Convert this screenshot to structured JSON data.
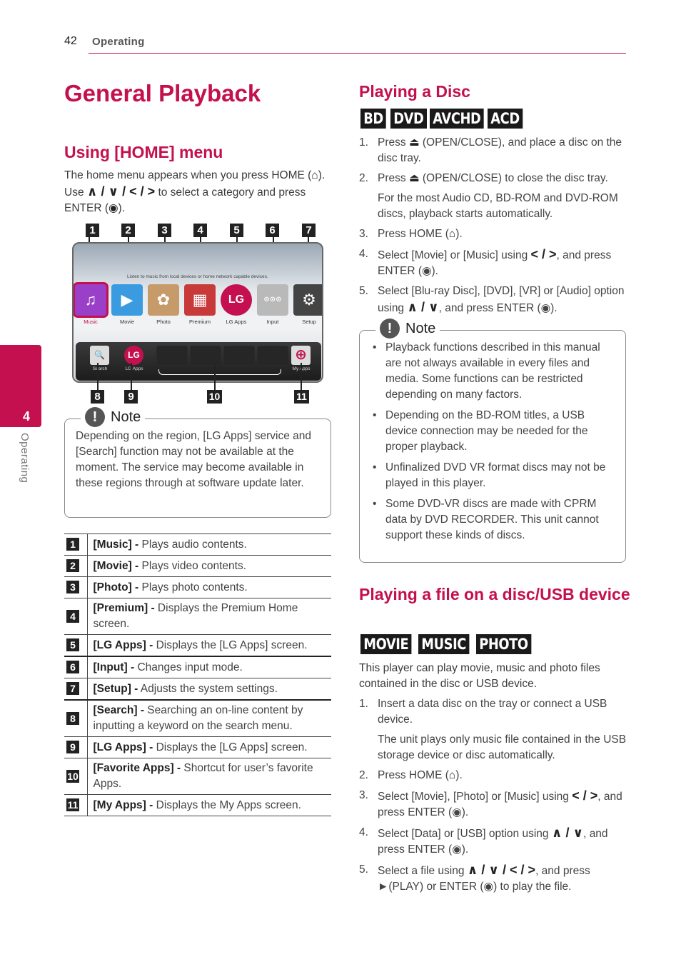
{
  "header": {
    "page_number": "42",
    "section": "Operating"
  },
  "side_tab": {
    "chapter_number": "4",
    "chapter_label": "Operating"
  },
  "title": "General Playback",
  "home_menu": {
    "heading": "Using [HOME] menu",
    "intro_1": "The home menu appears when you press HOME (",
    "home_icon": "⌂",
    "intro_2": "). Use ",
    "arrows_all": "∧ / ∨ / < / >",
    "intro_3": " to select a category and press ENTER (",
    "enter_icon": "◉",
    "intro_4": ").",
    "screen": {
      "hint": "Listen to music from local devices or home network capable devices.",
      "apps": [
        {
          "label": "Music",
          "icon": "music-note-icon",
          "glyph": "♫",
          "color": "#9a3fc7"
        },
        {
          "label": "Movie",
          "icon": "clapperboard-icon",
          "glyph": "▶",
          "color": "#3a9be0"
        },
        {
          "label": "Photo",
          "icon": "flower-photo-icon",
          "glyph": "✿",
          "color": "#c79a6a"
        },
        {
          "label": "Premium",
          "icon": "premium-grid-icon",
          "glyph": "▦",
          "color": "#c83a3a"
        },
        {
          "label": "LG Apps",
          "icon": "lg-logo-icon",
          "glyph": "LG",
          "color": "#c4104e"
        },
        {
          "label": "Input",
          "icon": "input-cable-icon",
          "glyph": "⊙⊙⊙",
          "color": "#b9b9b9"
        },
        {
          "label": "Setup",
          "icon": "gear-icon",
          "glyph": "⚙",
          "color": "#444444"
        }
      ],
      "dock": [
        {
          "label": "Search",
          "icon": "search-icon",
          "glyph": "🔍"
        },
        {
          "label": "LG Apps",
          "icon": "lg-logo-icon",
          "glyph": "LG"
        },
        {
          "label": "My Apps",
          "icon": "plus-circle-icon",
          "glyph": "⊕"
        }
      ]
    },
    "callouts_top": [
      "1",
      "2",
      "3",
      "4",
      "5",
      "6",
      "7"
    ],
    "callouts_bottom": [
      "8",
      "9",
      "10",
      "11"
    ],
    "note": {
      "title": "Note",
      "icon": "!",
      "text": "Depending on the region, [LG Apps] service and [Search] function may not be available at the moment. The service may become available in these regions through at software update later."
    },
    "table": [
      {
        "num": "1",
        "term": "[Music] -",
        "desc": " Plays audio contents."
      },
      {
        "num": "2",
        "term": "[Movie] -",
        "desc": " Plays video contents."
      },
      {
        "num": "3",
        "term": "[Photo] -",
        "desc": " Plays photo contents."
      },
      {
        "num": "4",
        "term": "[Premium] -",
        "desc": " Displays the Premium Home screen."
      },
      {
        "num": "5",
        "term": "[LG Apps] -",
        "desc": " Displays the [LG Apps] screen."
      },
      {
        "num": "6",
        "term": "[Input] -",
        "desc": " Changes input mode."
      },
      {
        "num": "7",
        "term": "[Setup] -",
        "desc": " Adjusts the system settings."
      },
      {
        "num": "8",
        "term": "[Search] -",
        "desc": " Searching an on-line content by inputting a keyword on the search menu."
      },
      {
        "num": "9",
        "term": "[LG Apps] -",
        "desc": " Displays the [LG Apps] screen."
      },
      {
        "num": "10",
        "term": "[Favorite Apps] -",
        "desc": " Shortcut for user’s favorite Apps."
      },
      {
        "num": "11",
        "term": "[My Apps] -",
        "desc": " Displays the My Apps screen."
      }
    ]
  },
  "playing_disc": {
    "heading": "Playing a Disc",
    "badges": [
      "BD",
      "DVD",
      "AVCHD",
      "ACD"
    ],
    "steps": [
      {
        "n": "1.",
        "a": "Press ",
        "sym": "⏏",
        "b": " (OPEN/CLOSE), and place a disc on the disc tray."
      },
      {
        "n": "2.",
        "a": "Press ",
        "sym": "⏏",
        "b": " (OPEN/CLOSE) to close the disc tray.",
        "sub": "For the most Audio CD, BD-ROM and DVD-ROM discs, playback starts automatically."
      },
      {
        "n": "3.",
        "a": "Press HOME (",
        "sym": "⌂",
        "b": ")."
      },
      {
        "n": "4.",
        "a": "Select [Movie] or [Music] using ",
        "sym": "< / >",
        "b": ", and press ENTER (◉)."
      },
      {
        "n": "5.",
        "a": "Select [Blu-ray Disc], [DVD], [VR] or [Audio] option using ",
        "sym": "∧ / ∨",
        "b": ", and press ENTER (◉)."
      }
    ],
    "note": {
      "title": "Note",
      "icon": "!",
      "bullets": [
        "Playback functions described in this manual are not always available in every files and media. Some functions can be restricted depending on many factors.",
        "Depending on the BD-ROM titles, a USB device connection may be needed for the proper playback.",
        "Unfinalized DVD VR format discs may not be played in this player.",
        "Some DVD-VR discs are made with CPRM data by DVD RECORDER. This unit cannot support these kinds of discs."
      ]
    }
  },
  "playing_file": {
    "heading": "Playing a file on a disc/USB device",
    "badges": [
      "MOVIE",
      "MUSIC",
      "PHOTO"
    ],
    "intro": "This player can play movie, music and photo files contained in the disc or USB device.",
    "steps": [
      {
        "n": "1.",
        "a": "Insert a data disc on the tray or connect a USB device.",
        "sym": "",
        "b": "",
        "sub": "The unit plays only music file contained in the USB storage device or disc automatically."
      },
      {
        "n": "2.",
        "a": "Press HOME (",
        "sym": "⌂",
        "b": ")."
      },
      {
        "n": "3.",
        "a": "Select [Movie], [Photo] or [Music] using ",
        "sym": "< / >",
        "b": ", and press ENTER (◉)."
      },
      {
        "n": "4.",
        "a": "Select [Data] or [USB] option using ",
        "sym": "∧ / ∨",
        "b": ", and press ENTER (◉)."
      },
      {
        "n": "5.",
        "a": "Select a file using ",
        "sym": "∧ / ∨ / < / >",
        "b": ", and press ►(PLAY) or ENTER (◉) to play the file."
      }
    ]
  },
  "colors": {
    "accent": "#c4104e",
    "badge": "#1a1a1a"
  }
}
